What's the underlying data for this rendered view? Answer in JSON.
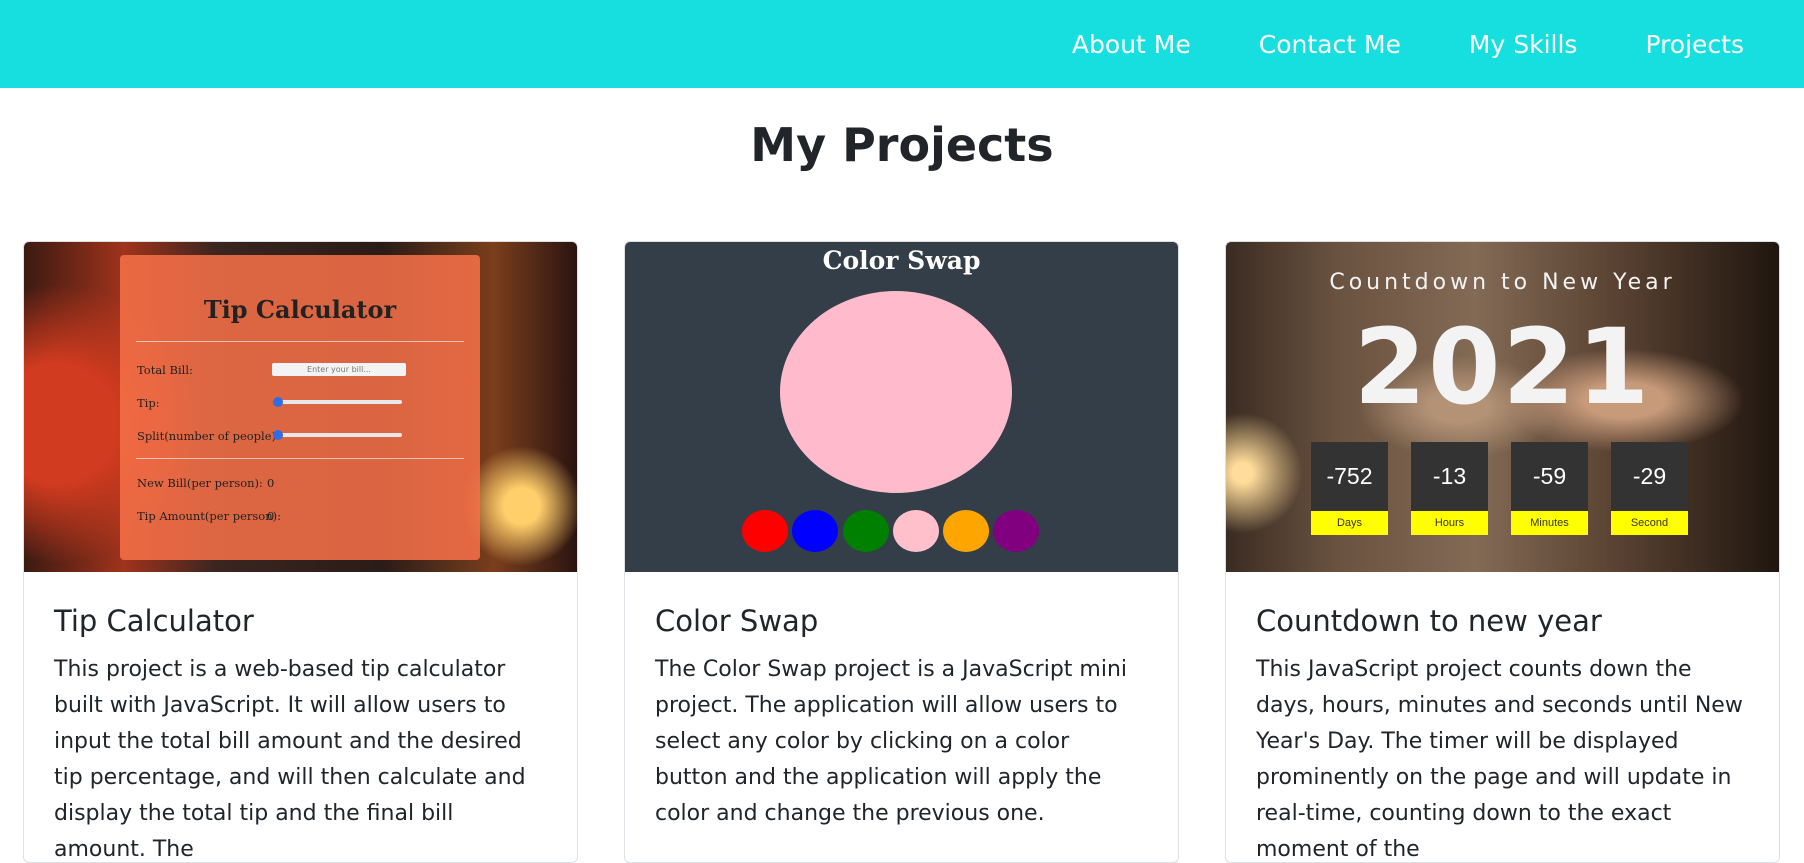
{
  "nav": {
    "links": [
      "About Me",
      "Contact Me",
      "My Skills",
      "Projects"
    ]
  },
  "page": {
    "title": "My Projects"
  },
  "projects": [
    {
      "title": "Tip Calculator",
      "description": "This project is a web-based tip calculator built with JavaScript. It will allow users to input the total bill amount and the desired tip percentage, and will then calculate and display the total tip and the final bill amount. The",
      "preview": {
        "heading": "Tip Calculator",
        "total_bill_label": "Total Bill:",
        "total_bill_placeholder": "Enter your bill...",
        "tip_label": "Tip:",
        "split_label": "Split(number of people)",
        "new_bill_label": "New Bill(per person):",
        "new_bill_value": "0",
        "tip_amount_label": "Tip Amount(per person):",
        "tip_amount_value": "0"
      }
    },
    {
      "title": "Color Swap",
      "description": "The Color Swap project is a JavaScript mini project. The application will allow users to select any color by clicking on a color button and the application will apply the color and change the previous one.",
      "preview": {
        "heading": "Color Swap",
        "current_color": "#ffbbcb",
        "swatches": [
          "#ff0000",
          "#0000ff",
          "#008000",
          "#ffc0cb",
          "#ffa500",
          "#800080"
        ]
      }
    },
    {
      "title": "Countdown to new year",
      "description": "This JavaScript project counts down the days, hours, minutes and seconds until New Year's Day. The timer will be displayed prominently on the page and will update in real-time, counting down to the exact moment of the",
      "preview": {
        "heading": "Countdown to New Year",
        "year": "2021",
        "units": [
          {
            "value": "-752",
            "label": "Days"
          },
          {
            "value": "-13",
            "label": "Hours"
          },
          {
            "value": "-59",
            "label": "Minutes"
          },
          {
            "value": "-29",
            "label": "Second"
          }
        ]
      }
    }
  ],
  "colors": {
    "navbar": "#17dfdf",
    "text": "#212529",
    "swap_bg": "#343e48",
    "countdown_label_bg": "#ffff00",
    "countdown_box_bg": "#333333"
  }
}
